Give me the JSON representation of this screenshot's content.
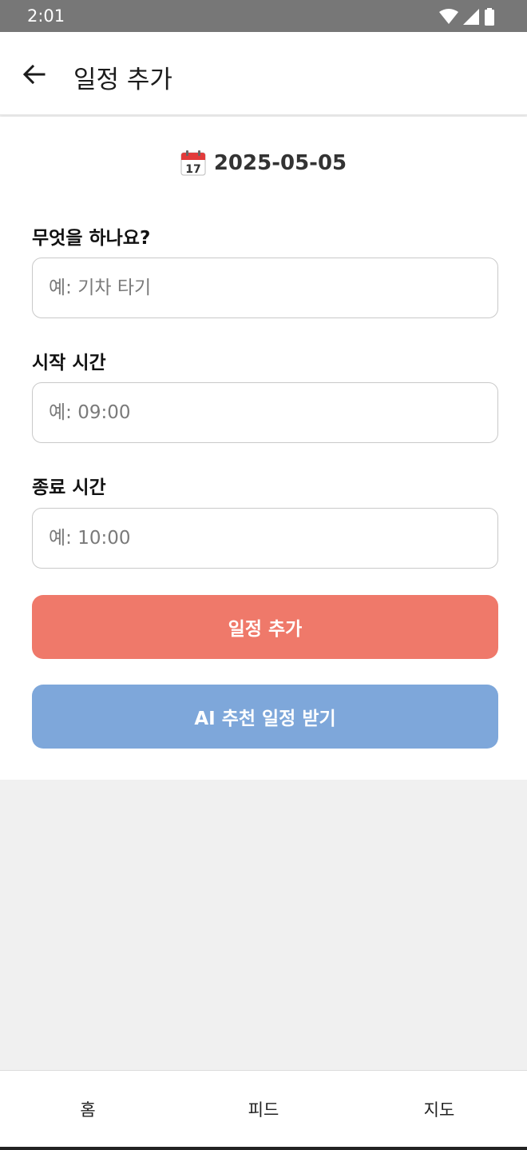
{
  "status_bar": {
    "time": "2:01"
  },
  "app_bar": {
    "title": "일정 추가"
  },
  "date": {
    "icon": "calendar-icon",
    "value": "2025-05-05"
  },
  "form": {
    "activity": {
      "label": "무엇을 하나요?",
      "placeholder": "예: 기차 타기",
      "value": ""
    },
    "start_time": {
      "label": "시작 시간",
      "placeholder": "예: 09:00",
      "value": ""
    },
    "end_time": {
      "label": "종료 시간",
      "placeholder": "예: 10:00",
      "value": ""
    }
  },
  "buttons": {
    "add_label": "일정 추가",
    "ai_label": "AI 추천 일정 받기"
  },
  "bottom_nav": {
    "items": [
      {
        "label": "홈"
      },
      {
        "label": "피드"
      },
      {
        "label": "지도"
      }
    ]
  },
  "colors": {
    "add_button": "#ef796a",
    "ai_button": "#7ea7da",
    "status_bar": "#777777"
  }
}
